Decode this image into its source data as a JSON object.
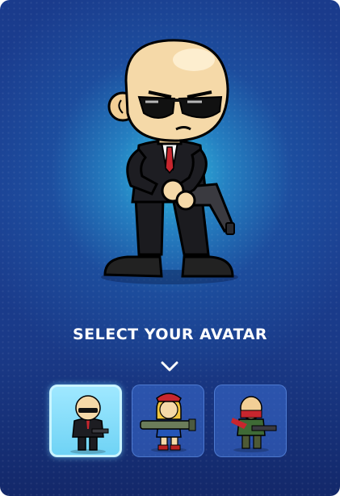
{
  "screen": {
    "title": "SELECT YOUR AVATAR"
  },
  "selected_avatar_index": 0,
  "avatars": [
    {
      "icon": "agent-avatar-icon",
      "selected": true
    },
    {
      "icon": "bazooka-girl-avatar-icon",
      "selected": false
    },
    {
      "icon": "commando-avatar-icon",
      "selected": false
    }
  ],
  "colors": {
    "background_top": "#1a3b8c",
    "background_glow": "#32c8e6",
    "selected_slot": "#7fdcf8",
    "slot": "#3c6ed2"
  }
}
